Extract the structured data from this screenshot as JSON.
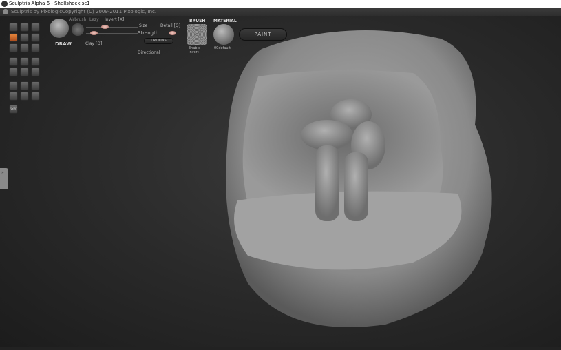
{
  "window": {
    "title": "Sculptris Alpha 6 - Shellshock.sc1"
  },
  "header": {
    "app": "Sculptris by Pixologic",
    "copyright": "Copyright (C) 2009-2011 Pixologic, Inc."
  },
  "tool": {
    "name": "DRAW",
    "airbrush": "Airbrush",
    "lazy": "Lazy",
    "invert": "Invert [X]",
    "clay": "Clay [D]",
    "size": "Size",
    "strength": "Strength",
    "detail": "Detail [Q]",
    "options": "OPTIONS",
    "directional": "Directional"
  },
  "brush": {
    "label": "BRUSH",
    "enable": "Enable",
    "invert": "Invert"
  },
  "material": {
    "label": "MATERIAL",
    "name": "00default"
  },
  "paint_button": "PAINT",
  "toolbar": {
    "bottom_label": "Gly"
  },
  "colors": {
    "active_tool": "#e0783a"
  }
}
